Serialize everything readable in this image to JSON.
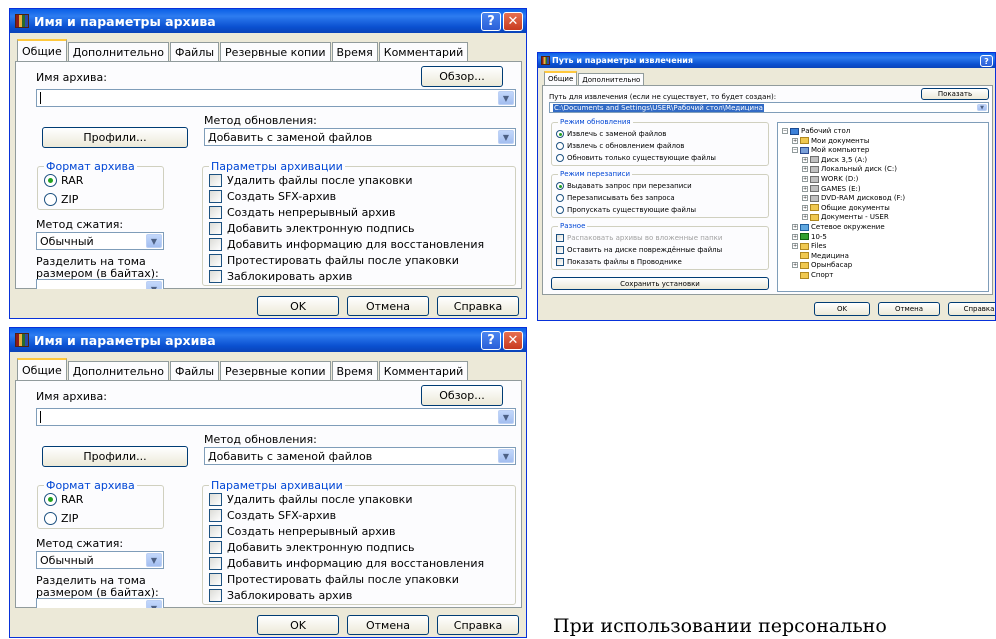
{
  "archive_dialog": {
    "title": "Имя и параметры архива",
    "help_label": "?",
    "close_label": "✕",
    "tabs": [
      "Общие",
      "Дополнительно",
      "Файлы",
      "Резервные копии",
      "Время",
      "Комментарий"
    ],
    "archive_name_label": "Имя архива:",
    "archive_name_value": "",
    "browse_label": "Обзор...",
    "update_method_label": "Метод обновления:",
    "update_method_value": "Добавить с заменой файлов",
    "profiles_label": "Профили...",
    "format_group_title": "Формат архива",
    "format_options": [
      "RAR",
      "ZIP"
    ],
    "format_selected": "RAR",
    "options_group_title": "Параметры архивации",
    "options": [
      "Удалить файлы после упаковки",
      "Создать SFX-архив",
      "Создать непрерывный архив",
      "Добавить электронную подпись",
      "Добавить информацию для восстановления",
      "Протестировать файлы после упаковки",
      "Заблокировать архив"
    ],
    "compression_label": "Метод сжатия:",
    "compression_value": "Обычный",
    "split_label_line1": "Разделить на тома",
    "split_label_line2": "размером (в байтах):",
    "split_value": "",
    "ok_label": "OK",
    "cancel_label": "Отмена",
    "help_button_label": "Справка"
  },
  "extract_dialog": {
    "title": "Путь и параметры извлечения",
    "help_label": "?",
    "tabs": [
      "Общие",
      "Дополнительно"
    ],
    "path_label": "Путь для извлечения (если не существует, то будет создан):",
    "path_value": "C:\\Documents and Settings\\USER\\Рабочий стол\\Медицина",
    "show_label": "Показать",
    "update_group_title": "Режим обновления",
    "update_options": [
      "Извлечь с заменой файлов",
      "Извлечь с обновлением файлов",
      "Обновить только существующие файлы"
    ],
    "overwrite_group_title": "Режим перезаписи",
    "overwrite_options": [
      "Выдавать запрос при перезаписи",
      "Перезаписывать без запроса",
      "Пропускать существующие файлы"
    ],
    "misc_group_title": "Разное",
    "misc_options": [
      "Распаковать архивы во вложенные папки",
      "Оставить на диске повреждённые файлы",
      "Показать файлы в Проводнике"
    ],
    "save_settings_label": "Сохранить установки",
    "tree": [
      {
        "label": "Рабочий стол",
        "icon": "desktop-icon",
        "level": 0,
        "expander": "−"
      },
      {
        "label": "Мои документы",
        "icon": "folder-icon",
        "level": 1,
        "expander": "+"
      },
      {
        "label": "Мой компьютер",
        "icon": "computer-icon",
        "level": 1,
        "expander": "−"
      },
      {
        "label": "Диск 3,5 (A:)",
        "icon": "drive-icon",
        "level": 2,
        "expander": "+"
      },
      {
        "label": "Локальный диск (C:)",
        "icon": "drive-icon",
        "level": 2,
        "expander": "+"
      },
      {
        "label": "WORK (D:)",
        "icon": "drive-icon",
        "level": 2,
        "expander": "+"
      },
      {
        "label": "GAMES (E:)",
        "icon": "drive-icon",
        "level": 2,
        "expander": "+"
      },
      {
        "label": "DVD-RAM дисковод (F:)",
        "icon": "drive-icon",
        "level": 2,
        "expander": "+"
      },
      {
        "label": "Общие документы",
        "icon": "folder-icon",
        "level": 2,
        "expander": "+"
      },
      {
        "label": "Документы - USER",
        "icon": "folder-icon",
        "level": 2,
        "expander": "+"
      },
      {
        "label": "Сетевое окружение",
        "icon": "network-icon",
        "level": 1,
        "expander": "+"
      },
      {
        "label": "10-5",
        "icon": "green-icon",
        "level": 1,
        "expander": "+"
      },
      {
        "label": "Files",
        "icon": "folder-icon",
        "level": 1,
        "expander": "+"
      },
      {
        "label": "Медицина",
        "icon": "folder-icon",
        "level": 1,
        "expander": ""
      },
      {
        "label": "Орынбасар",
        "icon": "folder-icon",
        "level": 1,
        "expander": "+"
      },
      {
        "label": "Спорт",
        "icon": "folder-icon",
        "level": 1,
        "expander": ""
      }
    ],
    "ok_label": "OK",
    "cancel_label": "Отмена",
    "help_button_label": "Справка"
  },
  "caption_text": "При использовании персонально",
  "colors": {
    "title_blue": "#0a5fe6",
    "group_title": "#0046d5",
    "face": "#ece9d8",
    "radio_green": "#21a121"
  }
}
